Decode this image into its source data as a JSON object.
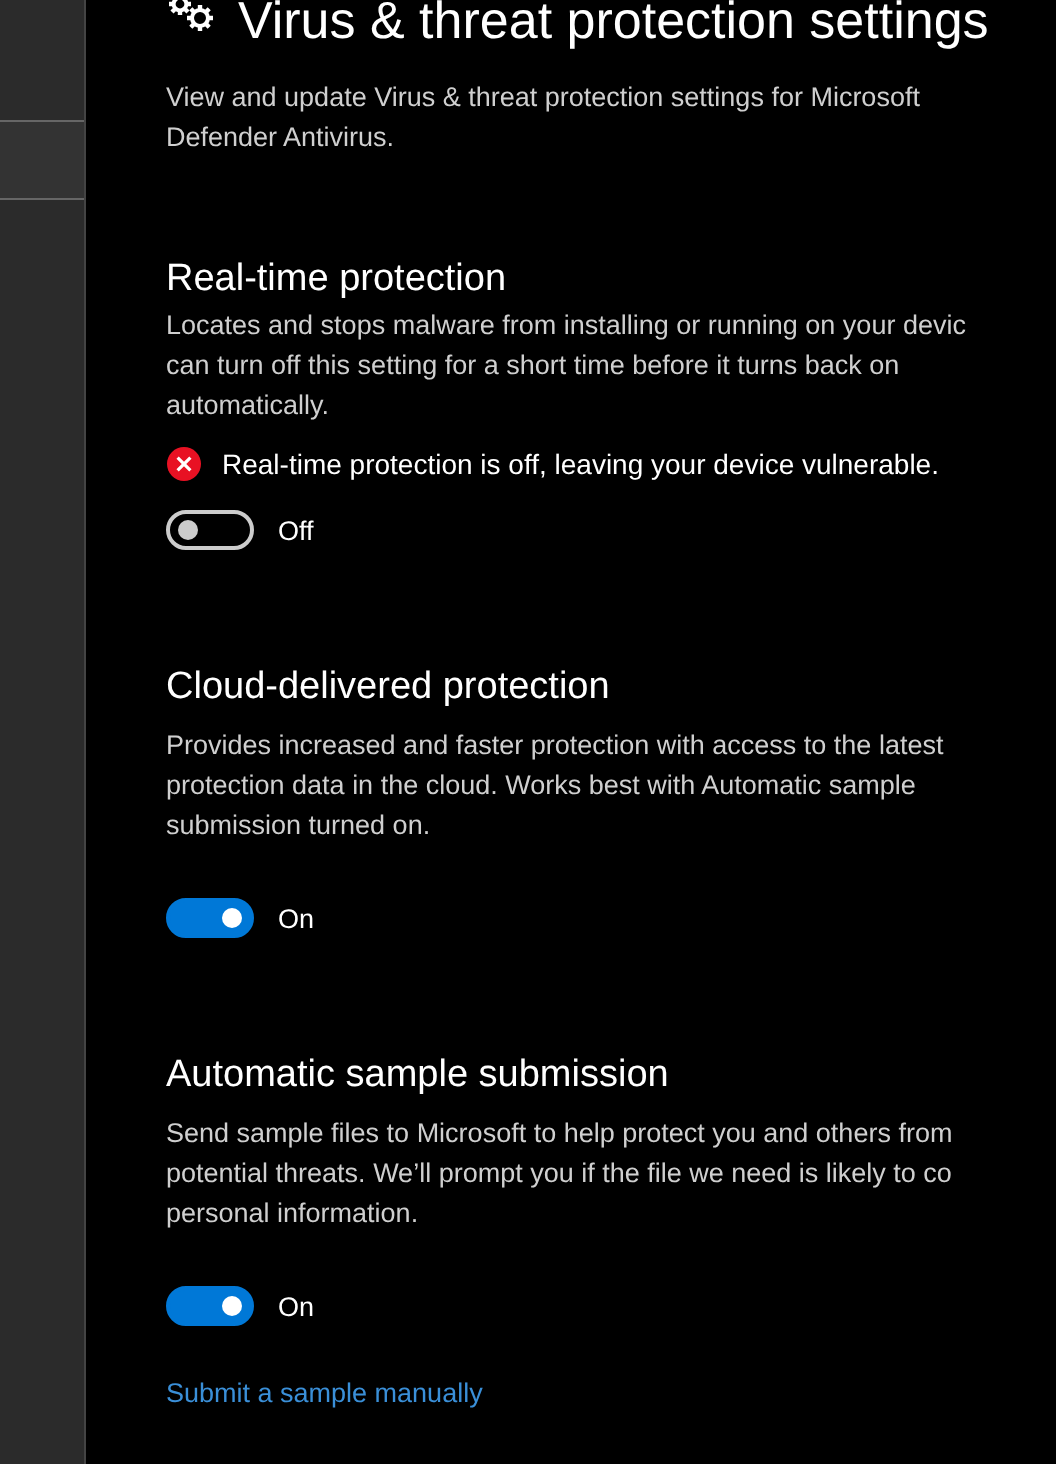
{
  "page": {
    "title": "Virus & threat protection settings",
    "description_lines": [
      "View and update Virus & threat protection settings for Microsoft",
      "Defender Antivirus."
    ]
  },
  "sections": [
    {
      "heading": "Real-time protection",
      "description_lines": [
        "Locates and stops malware from installing or running on your devic",
        "can turn off this setting for a short time before it turns back on",
        "automatically."
      ],
      "warning": "Real-time protection is off, leaving your device vulnerable.",
      "on": false,
      "toggle_label": "Off"
    },
    {
      "heading": "Cloud-delivered protection",
      "description_lines": [
        "Provides increased and faster protection with access to the latest",
        "protection data in the cloud. Works best with Automatic sample",
        "submission turned on."
      ],
      "on": true,
      "toggle_label": "On"
    },
    {
      "heading": "Automatic sample submission",
      "description_lines": [
        "Send sample files to Microsoft to help protect you and others from",
        "potential threats. We’ll prompt you if the file we need is likely to co",
        "personal information."
      ],
      "on": true,
      "toggle_label": "On",
      "link": "Submit a sample manually"
    }
  ]
}
